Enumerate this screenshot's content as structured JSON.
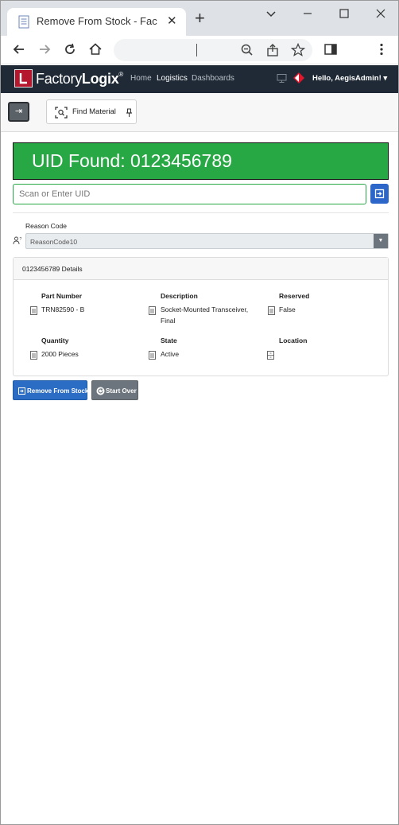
{
  "browser": {
    "tab_title": "Remove From Stock - FactoryLogix",
    "tab_close": "✕",
    "new_tab": "+"
  },
  "app_nav": {
    "logo_first": "Factory",
    "logo_second": "Logix",
    "logo_reg": "®",
    "links": [
      "Home",
      "Logistics",
      "Dashboards"
    ],
    "user_greeting": "Hello, AegisAdmin! ▾"
  },
  "action_bar": {
    "collapse_glyph": "⇥",
    "find_material_label": "Find Material"
  },
  "banner": {
    "text": "UID Found: 0123456789",
    "color": "#28a745"
  },
  "uid_input": {
    "placeholder": "Scan or Enter UID",
    "value": ""
  },
  "reason": {
    "label": "Reason Code",
    "selected": "ReasonCode10",
    "arrow": "▼"
  },
  "details": {
    "title": "0123456789 Details",
    "fields": [
      {
        "label": "Part Number",
        "value": "TRN82590 - B"
      },
      {
        "label": "Description",
        "value": "Socket-Mounted Transceiver, Final"
      },
      {
        "label": "Reserved",
        "value": "False"
      },
      {
        "label": "Quantity",
        "value": "2000 Pieces"
      },
      {
        "label": "State",
        "value": "Active"
      },
      {
        "label": "Location",
        "value": ""
      }
    ]
  },
  "buttons": {
    "remove_from_stock": "Remove From Stock",
    "start_over": "Start Over"
  },
  "colors": {
    "accent_blue": "#2b6cc4",
    "nav_bg": "#1f2a36",
    "brand_red": "#b5172f"
  }
}
